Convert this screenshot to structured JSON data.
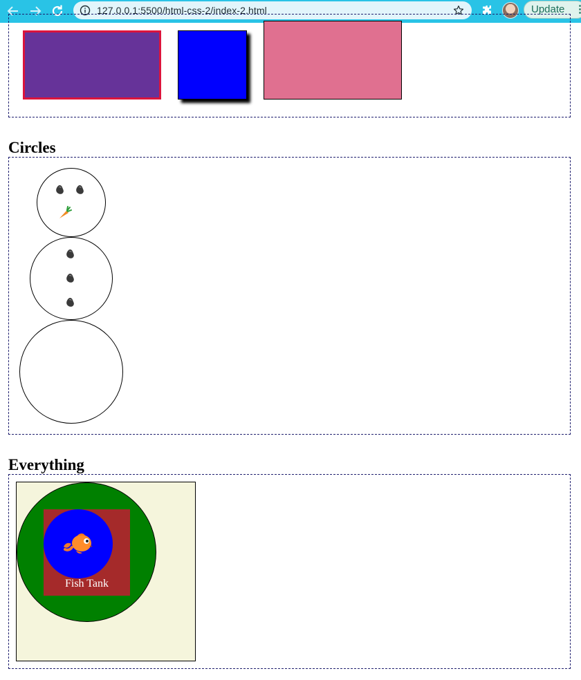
{
  "browser": {
    "url": "127.0.0.1:5500/html-css-2/index-2.html",
    "update_label": "Update",
    "menu_glyph": "⋮",
    "icons": [
      "back-arrow-icon",
      "forward-arrow-icon",
      "reload-icon",
      "info-icon",
      "star-icon",
      "extensions-puzzle-icon",
      "avatar"
    ]
  },
  "sections": {
    "rectangles": {
      "colors": {
        "purple": "#663399",
        "purple_border": "#dc143c",
        "blue": "#0000ff",
        "pink": "#e07090"
      }
    },
    "circles": {
      "heading": "Circles",
      "icons": [
        "coal-icon",
        "carrot-icon"
      ]
    },
    "everything": {
      "heading": "Everything",
      "tank_label": "Fish Tank",
      "colors": {
        "frame": "#f5f5dc",
        "outer_circle": "#008000",
        "square": "#a52a2a",
        "inner_circle": "#0000ff"
      },
      "icons": [
        "goldfish-icon"
      ]
    }
  }
}
